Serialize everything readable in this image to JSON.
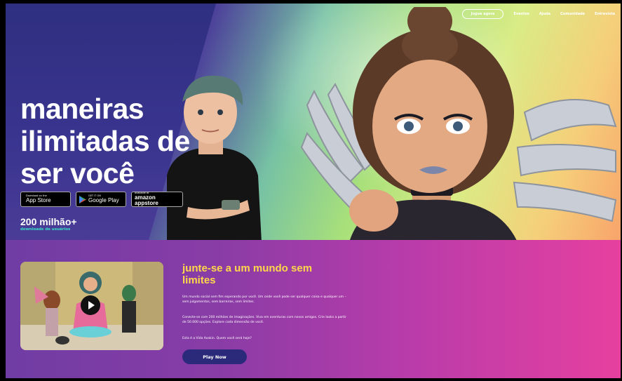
{
  "nav": {
    "join_label": "Jogue agora",
    "links": [
      "Eventos",
      "Ajuda",
      "Comunidade",
      "Entrevista"
    ]
  },
  "hero": {
    "headline_lines": [
      "maneiras",
      "ilimitadas de",
      "ser você"
    ],
    "badges": [
      {
        "small": "Download on the",
        "big": "App Store",
        "icon": "apple-icon"
      },
      {
        "small": "GET IT ON",
        "big": "Google Play",
        "icon": "google-play-icon"
      },
      {
        "small": "available at",
        "big": "amazon appstore",
        "icon": "amazon-icon"
      }
    ],
    "downloads_count": "200 milhão+",
    "downloads_label": "downloads de usuários"
  },
  "join": {
    "title": "junte-se a um mundo sem limites",
    "paragraphs": [
      "Um mundo social sem fim esperando por você. Um onde você pode ser qualquer coisa e qualquer um – sem julgamentos, sem barreiras, sem limites.",
      "Conecte-se com 200 milhões de imaginações. Viva em aventuras com novos amigos. Crie looks a partir de 50.000 opções. Explore cada dimensão de você.",
      "Esta é a Vida Avakin. Quem você será hoje?"
    ],
    "play_label": "Play Now"
  },
  "colors": {
    "hero_left": "#2e2f7e",
    "hero_right": "#f8a46a",
    "section_left": "#6f3da4",
    "section_right": "#e6409f",
    "title_yellow": "#ffd84a",
    "button_navy": "#2b2a7a",
    "downloads_teal": "#39e0c8"
  }
}
